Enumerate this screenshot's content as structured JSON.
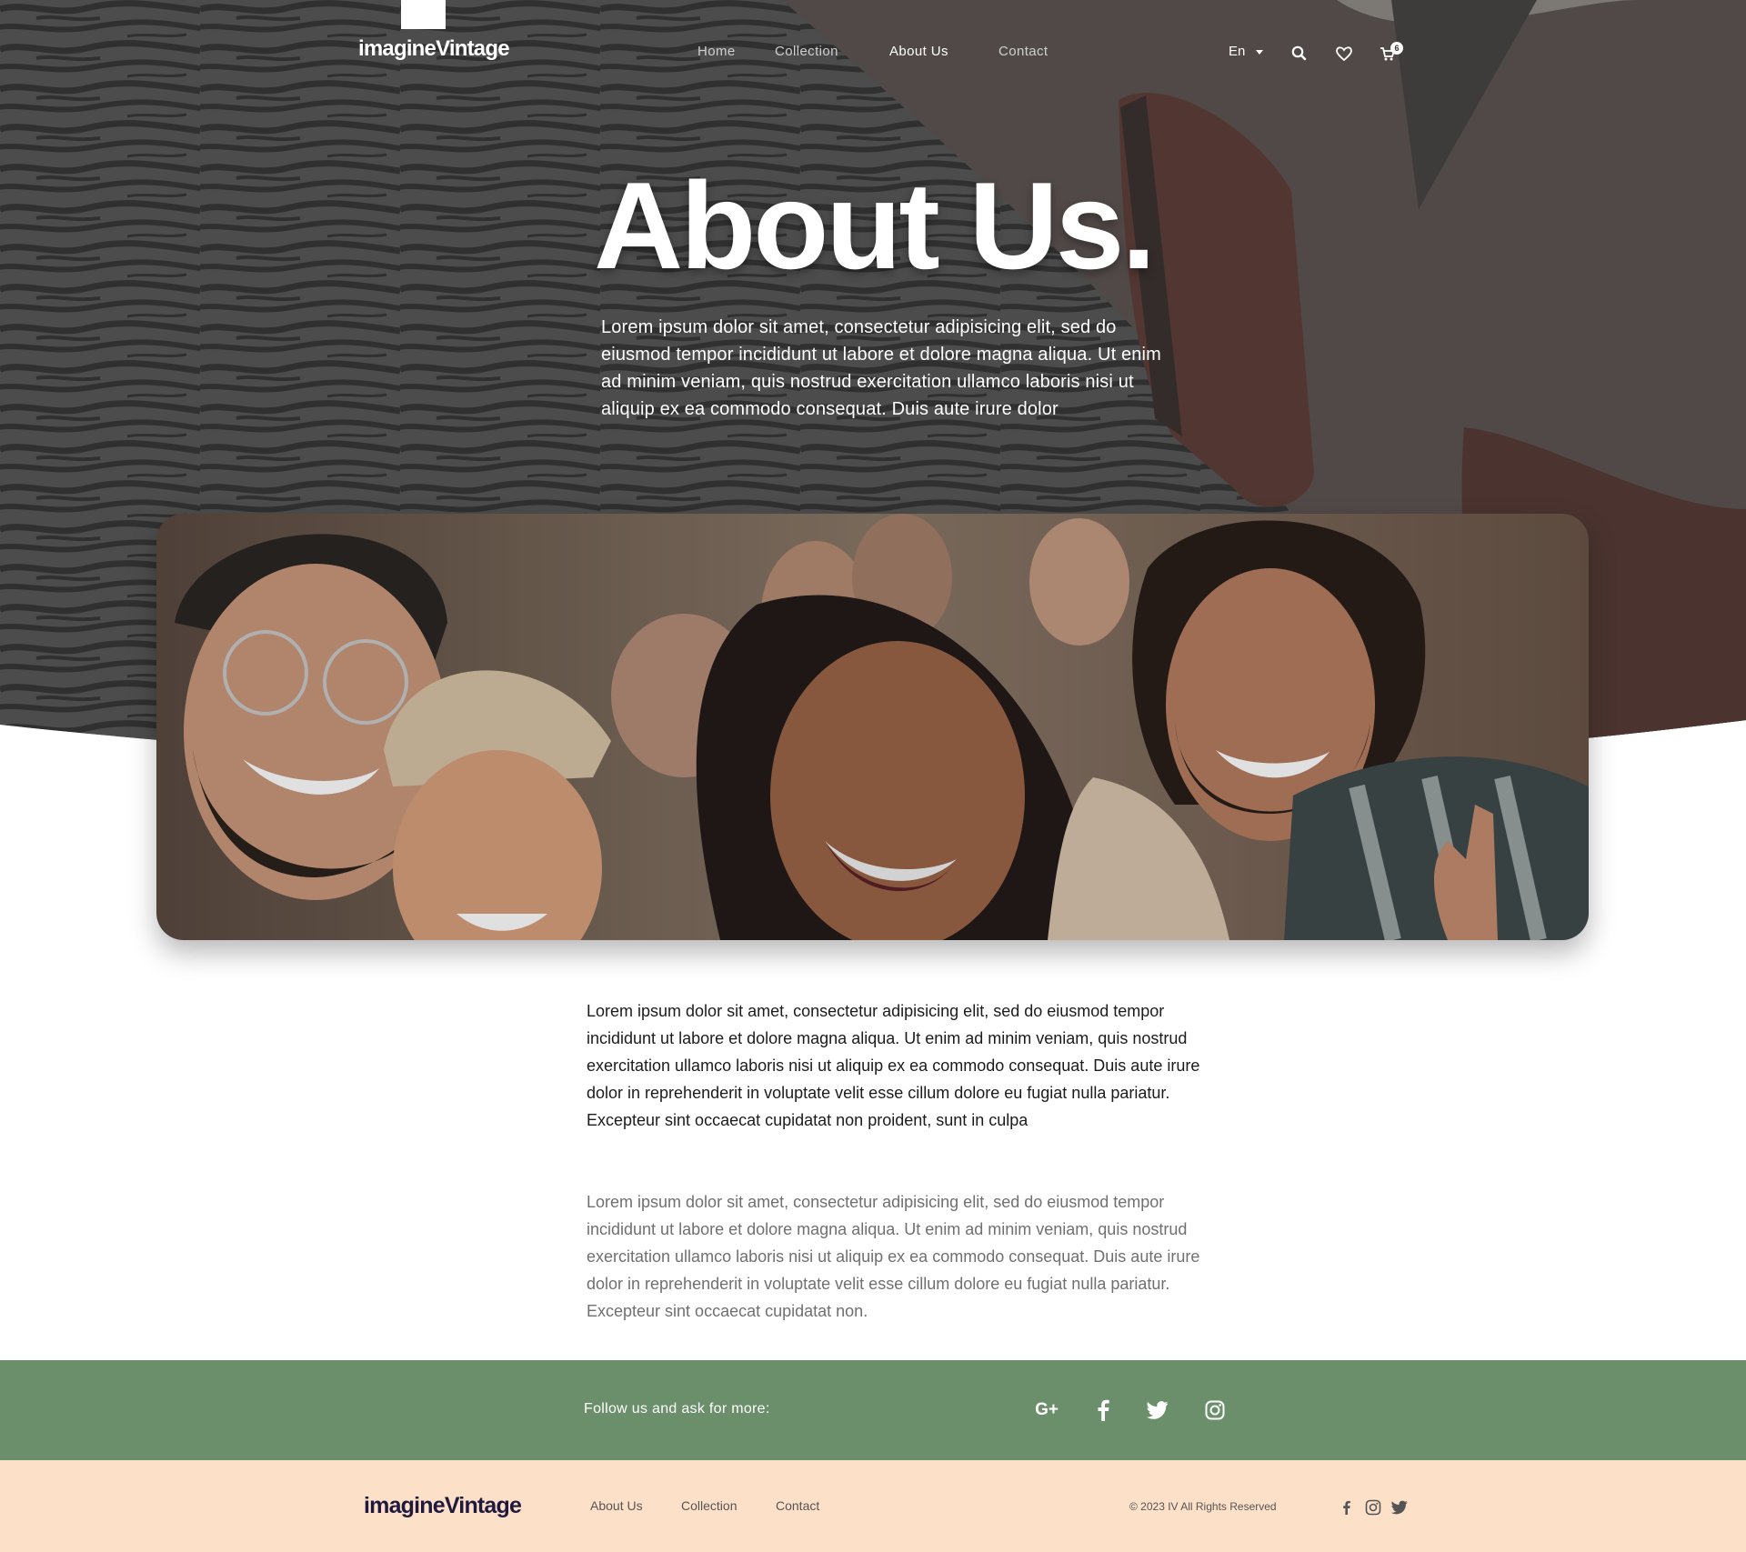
{
  "brand": {
    "logo": "imagineVintage",
    "footer_logo": "imagineVintage"
  },
  "nav": {
    "items": [
      {
        "label": "Home",
        "active": false
      },
      {
        "label": "Collection",
        "active": false
      },
      {
        "label": "About Us",
        "active": true
      },
      {
        "label": "Contact",
        "active": false
      }
    ],
    "language": "En",
    "cart_count": "6",
    "icons": [
      "search-icon",
      "heart-icon",
      "cart-icon"
    ]
  },
  "hero": {
    "title": "About Us.",
    "text": "Lorem ipsum dolor sit amet, consectetur adipisicing elit, sed do eiusmod tempor incididunt ut labore et dolore magna aliqua. Ut enim ad minim veniam, quis nostrud exercitation ullamco laboris nisi ut aliquip ex ea commodo consequat. Duis aute irure dolor"
  },
  "content": {
    "paragraph_1": "Lorem ipsum dolor sit amet, consectetur adipisicing elit, sed do eiusmod tempor incididunt ut labore et dolore magna aliqua. Ut enim ad minim veniam, quis nostrud exercitation ullamco laboris nisi ut aliquip ex ea commodo consequat. Duis aute irure dolor in reprehenderit in voluptate velit esse cillum dolore eu fugiat nulla pariatur. Excepteur sint occaecat cupidatat non proident, sunt in culpa",
    "paragraph_2": "Lorem ipsum dolor sit amet, consectetur adipisicing elit, sed do eiusmod tempor incididunt ut labore et dolore magna aliqua. Ut enim ad minim veniam, quis nostrud exercitation ullamco laboris nisi ut aliquip ex ea commodo consequat. Duis aute irure dolor in reprehenderit in voluptate velit esse cillum dolore eu fugiat nulla pariatur. Excepteur sint occaecat cupidatat non."
  },
  "follow": {
    "text": "Follow us and ask for more:",
    "social": [
      "google-plus-icon",
      "facebook-icon",
      "twitter-icon",
      "instagram-icon"
    ],
    "google_plus_glyph": "G+"
  },
  "footer": {
    "links": [
      "About Us",
      "Collection",
      "Contact"
    ],
    "copyright": "© 2023 IV All Rights Reserved",
    "social": [
      "facebook-icon",
      "instagram-icon",
      "twitter-icon"
    ]
  },
  "colors": {
    "hero_overlay": "#3d3d3d",
    "follow_bar": "#6b8f6b",
    "footer_bg": "#fde0c8",
    "footer_logo": "#1f1a3d"
  }
}
